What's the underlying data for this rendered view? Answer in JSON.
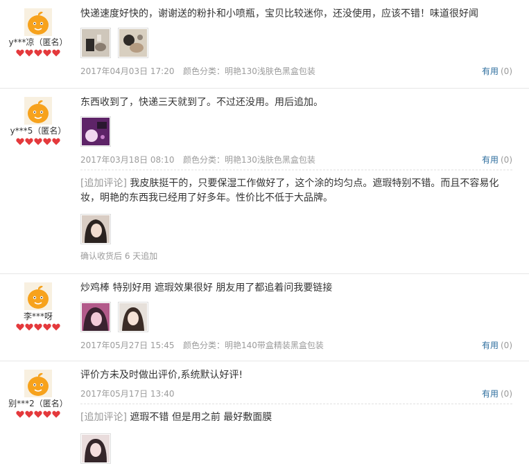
{
  "reviews": [
    {
      "user_name": "y***凉（匿名）",
      "text": "快递速度好快的，谢谢送的粉扑和小喷瓶，宝贝比较迷你，还没使用，应该不错！味道很好闻",
      "date": "2017年04月03日 17:20",
      "sku": "颜色分类：明艳130浅肤色黑盒包装",
      "useful_label": "有用",
      "useful_count": "(0)"
    },
    {
      "user_name": "y***5（匿名）",
      "text": "东西收到了，快递三天就到了。不过还没用。用后追加。",
      "date": "2017年03月18日 08:10",
      "sku": "颜色分类：明艳130浅肤色黑盒包装",
      "useful_label": "有用",
      "useful_count": "(0)",
      "append": {
        "tag": "[追加评论]",
        "text": "我皮肤挺干的，只要保湿工作做好了，这个涂的均匀点。遮瑕特别不错。而且不容易化妆，明艳的东西我已经用了好多年。性价比不低于大品牌。",
        "after": "确认收货后 6 天追加"
      }
    },
    {
      "user_name": "李***呀",
      "text": "炒鸡棒 特别好用 遮瑕效果很好 朋友用了都追着问我要链接",
      "date": "2017年05月27日 15:45",
      "sku": "颜色分类：明艳140带盒精装黑盒包装",
      "useful_label": "有用",
      "useful_count": "(0)"
    },
    {
      "user_name": "别***2（匿名）",
      "text": "评价方未及时做出评价,系统默认好评!",
      "date": "2017年05月17日 13:40",
      "useful_label": "有用",
      "useful_count": "(0)",
      "append": {
        "tag": "[追加评论]",
        "text": "遮瑕不错 但是用之前 最好敷面膜"
      }
    }
  ],
  "colors": {
    "avatar_orange": "#f7a21c",
    "heart_red": "#e4393c",
    "link_blue": "#2e6e9e"
  },
  "icons": {
    "avatar": "orange-mascot-avatar-icon",
    "rank": "red-heart-icon"
  }
}
